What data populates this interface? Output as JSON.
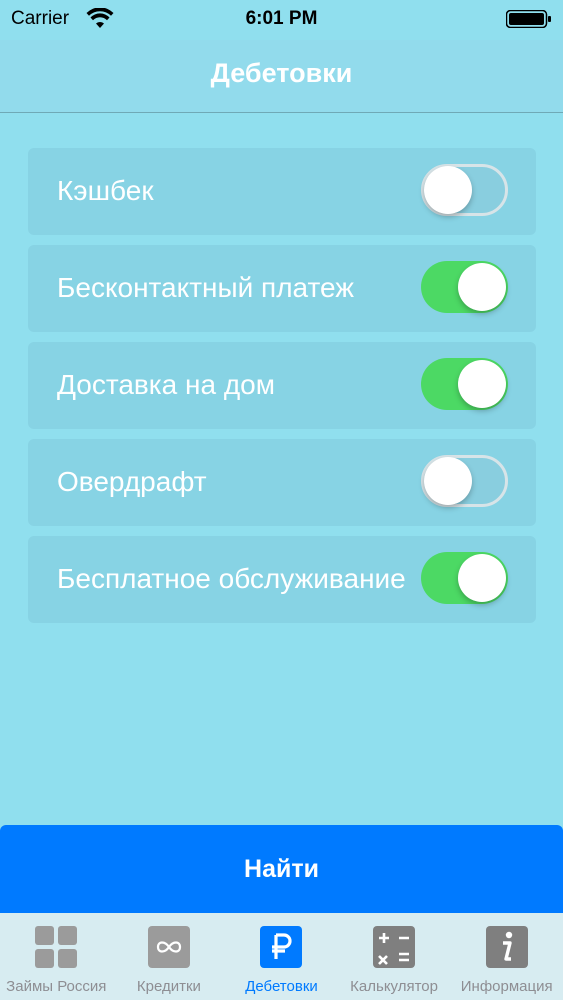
{
  "status_bar": {
    "carrier": "Carrier",
    "time": "6:01 PM"
  },
  "nav": {
    "title": "Дебетовки"
  },
  "filters": [
    {
      "label": "Кэшбек",
      "on": false
    },
    {
      "label": "Бесконтактный платеж",
      "on": true
    },
    {
      "label": "Доставка на дом",
      "on": true
    },
    {
      "label": "Овердрафт",
      "on": false
    },
    {
      "label": "Бесплатное обслуживание",
      "on": true
    }
  ],
  "find_button": {
    "label": "Найти"
  },
  "tabs": [
    {
      "label": "Займы Россия",
      "icon": "grid-icon",
      "active": false
    },
    {
      "label": "Кредитки",
      "icon": "infinity-icon",
      "active": false
    },
    {
      "label": "Дебетовки",
      "icon": "ruble-icon",
      "active": true
    },
    {
      "label": "Калькулятор",
      "icon": "calculator-icon",
      "active": false
    },
    {
      "label": "Информация",
      "icon": "info-icon",
      "active": false
    }
  ],
  "colors": {
    "background": "#90dfee",
    "toggle_on": "#4cd964",
    "accent": "#007aff",
    "tab_inactive": "#8e8e93"
  }
}
